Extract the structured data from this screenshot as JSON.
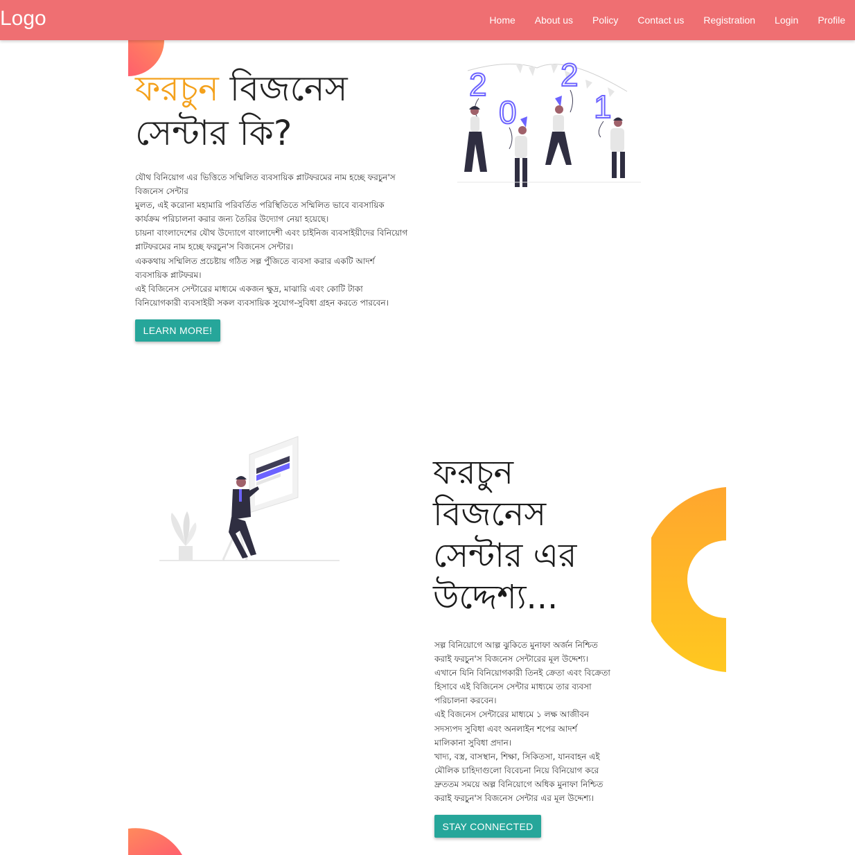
{
  "navbar": {
    "logo": "Logo",
    "links": [
      "Home",
      "About us",
      "Policy",
      "Contact us",
      "Registration",
      "Login",
      "Profile"
    ]
  },
  "section1": {
    "title_accent": "ফরচুন",
    "title_rest": " বিজনেস সেন্টার কি?",
    "paragraph_lines": [
      "যৌথ বিনিয়োগ এর ভিত্তিতে সম্মিলিত ব্যবসায়িক প্লাটফরমের নাম হচ্ছে ফরচুন'স",
      "বিজনেস সেন্টার",
      "মুলত, এই করোনা মহামারি পরিবর্তিত পরিস্থিতিতে সম্মিলিত ভাবে ব্যবসায়িক",
      "কার্যক্রম পরিচালনা করার জন্য তৈরির উদ্যোগ নেয়া হয়েছে।",
      "চায়না বাংলাদেশের যৌথ উদ্যোগে বাংলাদেশী এবং চাইনিজ ব্যবসাইয়ীদের বিনিয়োগ",
      "প্লাটফরমের নাম হচ্ছে ফরচুন'স বিজনেস সেন্টার।",
      "এককথায় সম্মিলিত প্রচেষ্টায় গঠিত সল্প পুঁজিতে ব্যবসা করার একটি আদর্শ",
      "ব্যবসায়িক প্লাটফরম।",
      "এই বিজিনেস সেন্টারের মাধ্যমে একজন ক্ষুদ্র, মাঝারি এবং কোটি টাকা",
      "বিনিয়োগকারী ব্যবসাইয়ী সকল ব্যবসায়িক সুযোগ-সুবিধা গ্রহন করতে পারবেন।"
    ],
    "button_label": "LEARN MORE!",
    "illustration_digits": [
      "2",
      "0",
      "2",
      "1"
    ]
  },
  "section2": {
    "title": "ফরচুন বিজনেস সেন্টার এর উদ্দেশ্য...",
    "paragraph_lines": [
      "সল্প বিনিয়োগে আল্প ঝুকিতে মুনাফা অর্জন নিশ্চিত",
      "করাই ফরচুন'স বিজনেস সেন্টারের মূল উদ্দেশ্য।",
      "এখানে যিনি বিনিয়োগকারী তিনই ক্রেতা এবং বিক্রেতা",
      "হিসাবে এই বিজিনেস সেন্টার মাধ্যমে তার ব্যবসা",
      "পরিচালনা করবেন।",
      "এই বিজনেস সেন্টারের মাধ্যমে ১ লক্ষ আজীবন",
      "সদস্যপদ সুবিধা এবং অনলাইন শপের আদর্শ",
      "মালিকানা সুবিধা প্রদান।",
      "খাদ্য, বস্ত্র, বাসস্থান, শিক্ষা, সিকিতসা, যানবাহন এই",
      "মৌলিক চাহিদাগুলো বিবেচনা নিয়ে বিনিয়োগ করে",
      "দ্রুততম সময়ে অল্প বিনিয়োগে অধিক মুনাফা নিশ্চিত",
      "করাই ফরচুন'স বিজনেস সেন্টার এর মূল উদ্দেশ্য।"
    ],
    "button_label": "STAY CONNECTED"
  },
  "colors": {
    "navbar": "#ef6f72",
    "accent_orange": "#f4a11c",
    "button_teal": "#26a69a",
    "illustration_purple": "#6c63ff",
    "coral": "#ff6f61"
  },
  "icons": [
    "celebration-2021-illustration",
    "presentation-illustration",
    "plant-icon"
  ]
}
